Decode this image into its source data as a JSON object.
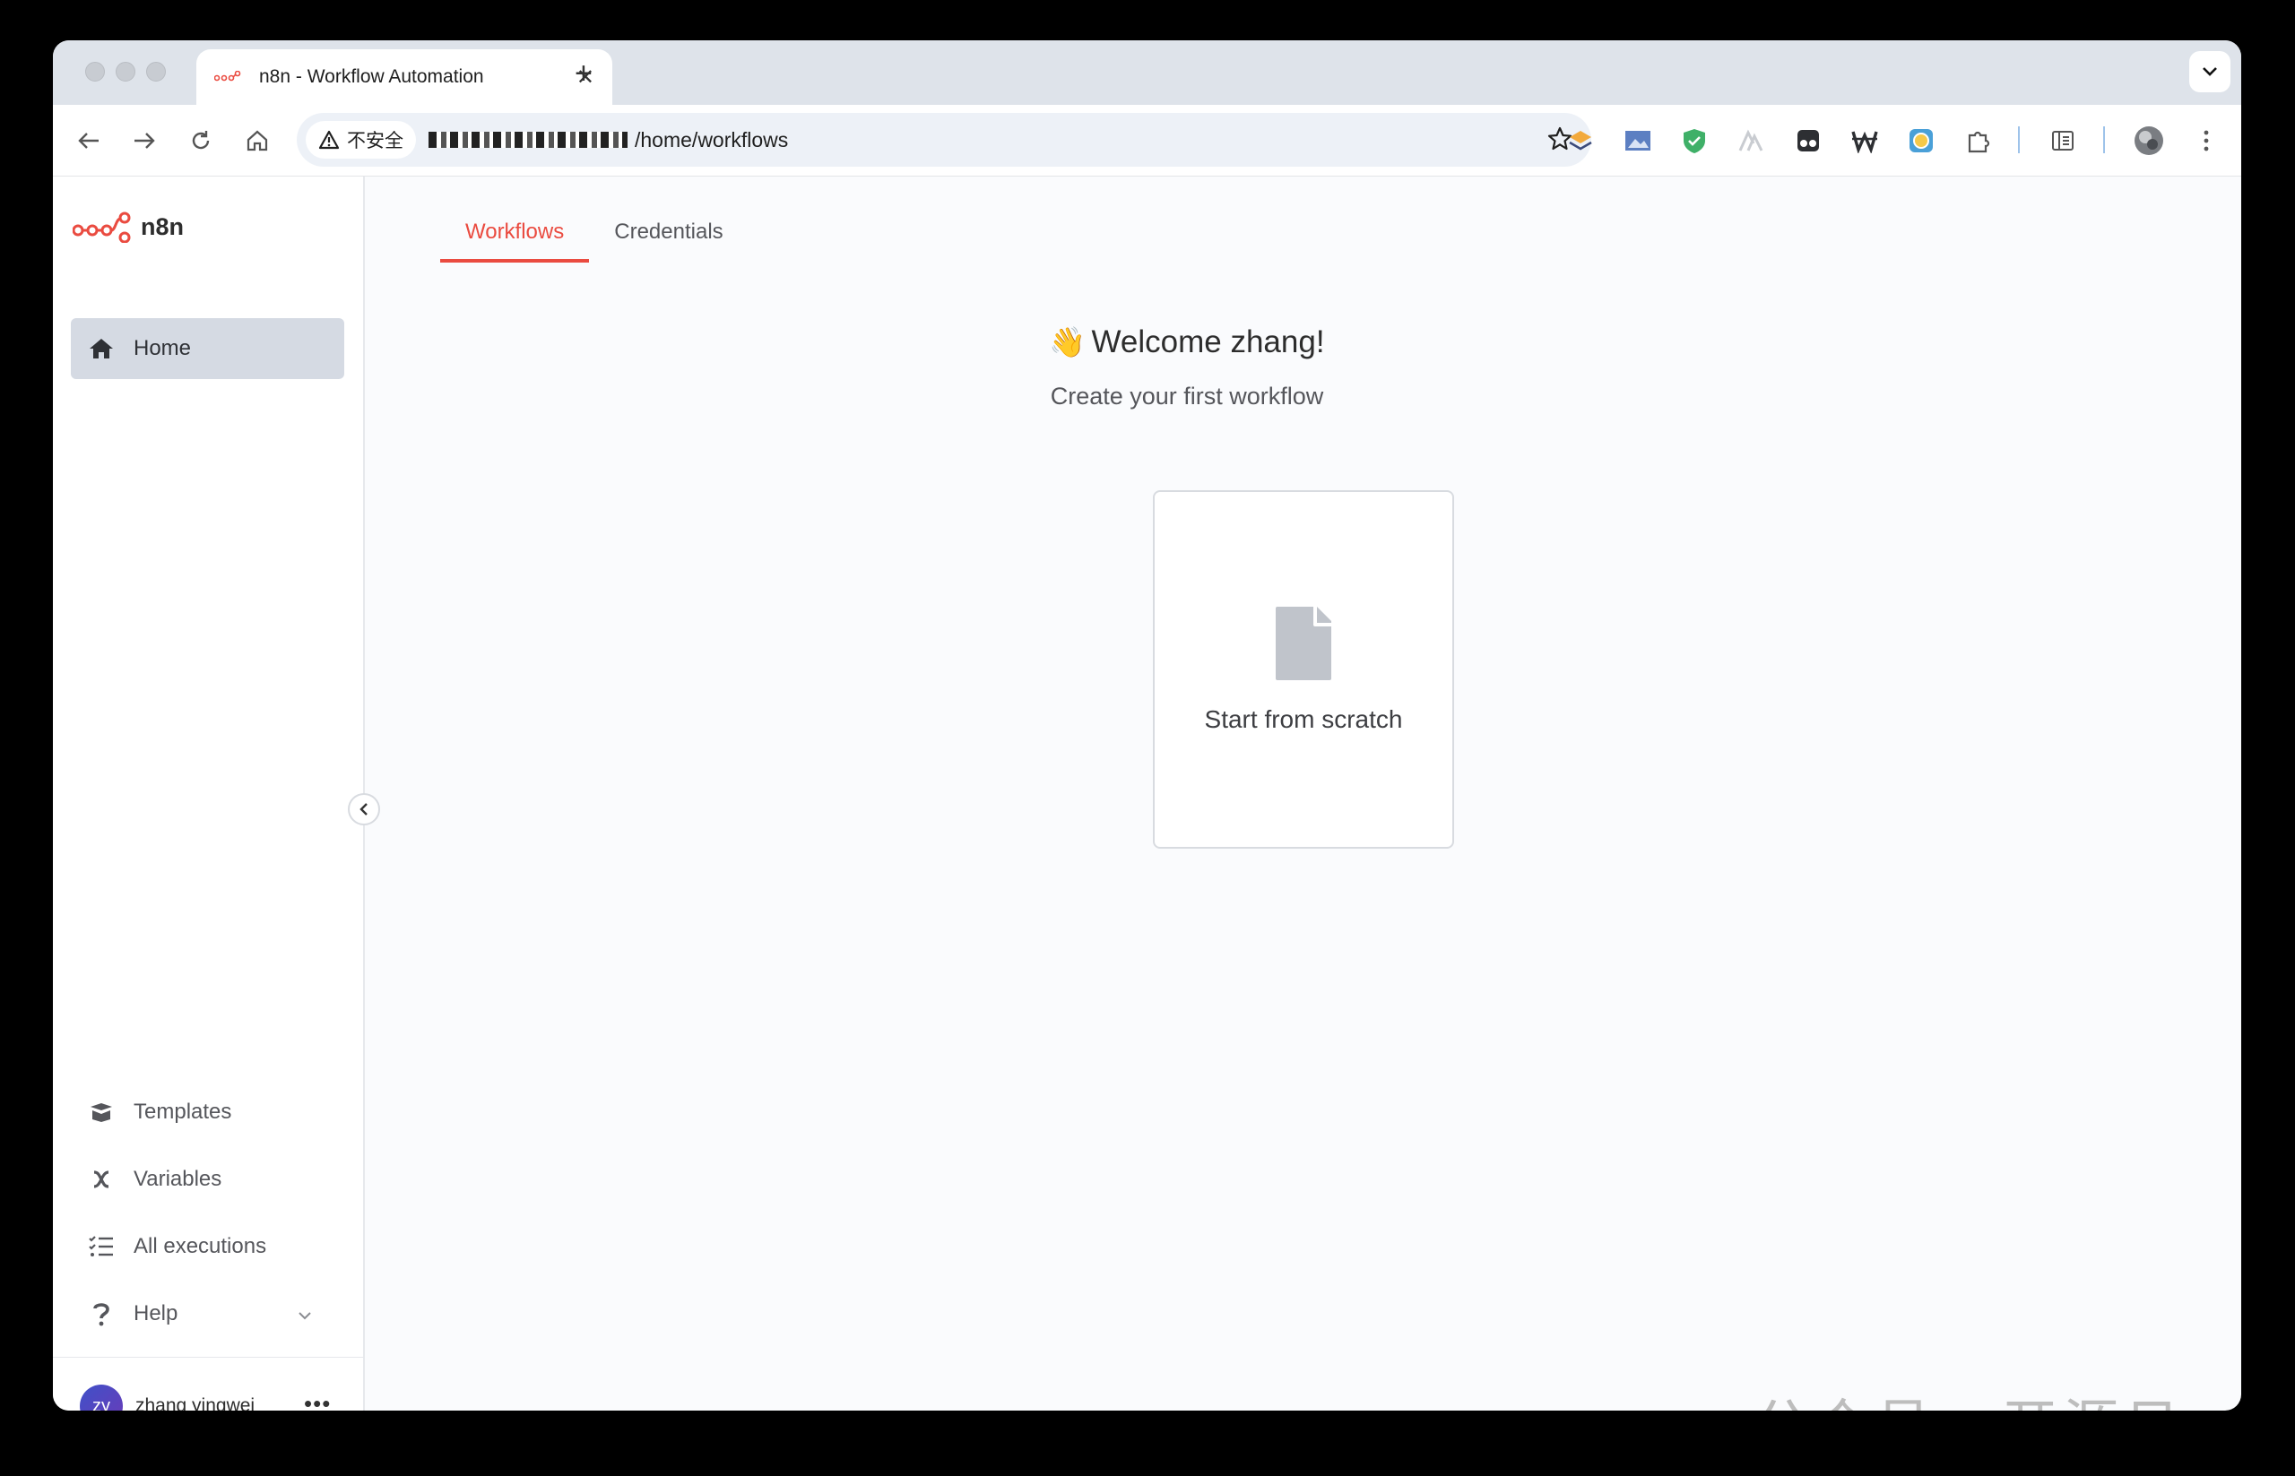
{
  "browser": {
    "tab_title": "n8n - Workflow Automation",
    "new_tab_symbol": "+",
    "security_label": "不安全",
    "url_path": "/home/workflows"
  },
  "app": {
    "logo_text": "n8n",
    "brand_color": "#ea4b40"
  },
  "sidebar": {
    "home": "Home",
    "templates": "Templates",
    "variables": "Variables",
    "executions": "All executions",
    "help": "Help"
  },
  "user": {
    "initials": "zy",
    "name": "zhang yingwei",
    "menu": "•••"
  },
  "main": {
    "tabs": [
      {
        "label": "Workflows",
        "active": true
      },
      {
        "label": "Credentials",
        "active": false
      }
    ],
    "welcome_emoji": "👋",
    "welcome": "Welcome zhang!",
    "subtitle": "Create your first workflow",
    "card_label": "Start from scratch"
  },
  "watermark": "公众号 · 开源日记"
}
